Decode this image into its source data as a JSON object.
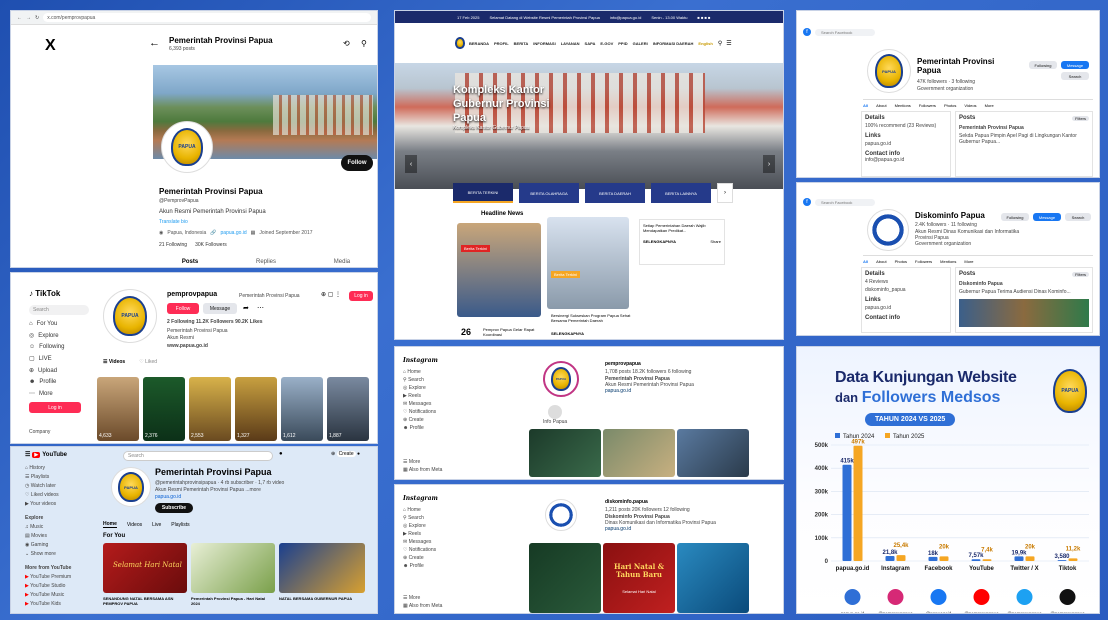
{
  "x_panel": {
    "url": "x.com/pemprovpapua",
    "brand": "X",
    "name": "Pemerintah Provinsi Papua",
    "posts_count": "6,393 posts",
    "handle": "@PemprovPapua",
    "bio": "Akun Resmi Pemerintah Provinsi Papua",
    "translate": "Translate bio",
    "location": "Papua, Indonesia",
    "website": "papua.go.id",
    "joined": "Joined September 2017",
    "following": "21 Following",
    "followers": "30K Followers",
    "follow_btn": "Follow",
    "tabs": [
      "Posts",
      "Replies",
      "Media"
    ],
    "logo_text": "PAPUA"
  },
  "tiktok_panel": {
    "brand": "TikTok",
    "search": "Search",
    "nav": [
      "For You",
      "Explore",
      "Following",
      "LIVE",
      "Upload",
      "Profile",
      "More"
    ],
    "login": "Log in",
    "company": "Company",
    "username": "pemprovpapua",
    "display_name": "Pemerintah Provinsi Papua",
    "follow_btn": "Follow",
    "message_btn": "Message",
    "stats": "2 Following  11.2K Followers  90.2K Likes",
    "bio1": "Pemerintah Provinsi Papua",
    "bio2": "Akun Resmi",
    "link": "www.papua.go.id",
    "tabs": [
      "Videos",
      "Liked"
    ],
    "login_top": "Log in",
    "views": [
      "4,633",
      "2,376",
      "2,553",
      "1,327",
      "1,612",
      "1,887"
    ]
  },
  "youtube_panel": {
    "brand": "YouTube",
    "search": "Search",
    "channel_name": "Pemerintah Provinsi Papua",
    "channel_meta": "@pemerintahprovinsipapua · 4 rb subscriber · 1,7 rb video",
    "channel_desc": "Akun Resmi Pemerintah Provinsi Papua ...more",
    "channel_link": "papua.go.id",
    "subscribe": "Subscribe",
    "tabs": [
      "Home",
      "Videos",
      "Live",
      "Playlists"
    ],
    "section": "For You",
    "sidebar": [
      "Home",
      "Shorts",
      "Subscriptions",
      "You",
      "History",
      "Playlists",
      "Watch later",
      "Liked videos",
      "Your videos",
      "Explore",
      "Music",
      "Movies",
      "Gaming",
      "Show more"
    ],
    "more_from": "More from YouTube",
    "more_items": [
      "YouTube Premium",
      "YouTube Studio",
      "YouTube Music",
      "YouTube Kids"
    ],
    "video_titles": [
      "SENANDUNG NATAL BERSAMA ASN PEMPROV PAPUA",
      "Pemerintah Provinsi Papua - Hari Natal 2024",
      "NATAL BERSAMA GUBERNUR PAPUA"
    ],
    "video_banner": "Selamat Hari Natal"
  },
  "web_panel": {
    "topbar": "Selamat Datang di Website Resmi Pemerintah Provinsi Papua",
    "topbar_email": "info@papua.go.id",
    "topbar_hours": "Senin - 13.00 Waktu",
    "date": "17 Feb 2025",
    "nav": [
      "BERANDA",
      "PROFIL",
      "BERITA",
      "INFORMASI",
      "LAYANAN",
      "SAPA",
      "E-GOV",
      "PPID",
      "GALERI",
      "INFORMASI DAERAH"
    ],
    "lang": "English",
    "hero_title": "Kompleks Kantor Gubernur Provinsi Papua",
    "hero_sub": "Kompleks Kantor Gubernur Papua",
    "tabs": [
      "BERITA TERKINI",
      "BERITA OLAHRAGA",
      "BERITA DAERAH",
      "BERITA LAINNYA"
    ],
    "headline": "Headline News",
    "news_badge": "Berita Terkini",
    "news_badge2": "Berita Terkini",
    "day": "26",
    "news1": "Pemprov Papua Gelar Rapat Koordinasi",
    "news2": "Bersinergi Sukseskan Program Papua Sehat Bersama Pemerintah Daerah",
    "news2_more": "SELENGKAPNYA",
    "side_text": "Setiap Pemerintahan Daerah Wajib Mendapatkan Predikat...",
    "side_more": "SELENGKAPNYA",
    "side_share": "Share"
  },
  "fb_pemprov": {
    "search": "Search Facebook",
    "name": "Pemerintah Provinsi Papua",
    "meta": "47K followers · 3 following",
    "category": "Government organization",
    "btn_following": "Following",
    "btn_message": "Message",
    "btn_search": "Search",
    "tabs": [
      "All",
      "About",
      "Mentions",
      "Followers",
      "Photos",
      "Videos",
      "More"
    ],
    "details": "Details",
    "details_rating": "100% recommend (23 Reviews)",
    "links": "Links",
    "link1": "papua.go.id",
    "contact": "Contact info",
    "contact1": "info@papua.go.id",
    "posts": "Posts",
    "filters": "Filters",
    "post_author": "Pemerintah Provinsi Papua",
    "post_text": "Sekda Papua Pimpin Apel Pagi di Lingkungan Kantor Gubernur Papua..."
  },
  "fb_diskominfo": {
    "search": "Search Facebook",
    "name": "Diskominfo Papua",
    "meta": "2.4K followers · 11 following",
    "desc": "Akun Resmi Dinas Komunikasi dan Informatika Provinsi Papua",
    "category": "Government organization",
    "btn_following": "Following",
    "btn_message": "Message",
    "btn_search": "Search",
    "tabs": [
      "All",
      "About",
      "Photos",
      "Followers",
      "Mentions",
      "More"
    ],
    "details": "Details",
    "rating": "4 Reviews",
    "ig": "diskominfo_papua",
    "links": "Links",
    "link1": "papua.go.id",
    "contact": "Contact info",
    "posts": "Posts",
    "filters": "Filters",
    "post_author": "Diskominfo Papua",
    "post_text": "Gubernur Papua Terima Audiensi Dinas Kominfo..."
  },
  "ig_panel1": {
    "brand": "Instagram",
    "nav": [
      "Home",
      "Search",
      "Explore",
      "Reels",
      "Messages",
      "Notifications",
      "Create",
      "Profile"
    ],
    "more": "More",
    "also": "Also from Meta",
    "username": "pemprovpapua",
    "display": "Pemerintah Provinsi Papua",
    "stats": "1,708 posts  18.2K followers  6 following",
    "bio": "Akun Resmi Pemerintah Provinsi Papua",
    "link": "papua.go.id",
    "highlight": "Info Papua"
  },
  "ig_panel2": {
    "brand": "Instagram",
    "nav": [
      "Home",
      "Search",
      "Explore",
      "Reels",
      "Messages",
      "Notifications",
      "Create",
      "Profile"
    ],
    "more": "More",
    "also": "Also from Meta",
    "username": "diskominfo.papua",
    "display": "Diskominfo Provinsi Papua",
    "stats": "1,211 posts  20K followers  12 following",
    "bio": "Dinas Komunikasi dan Informatika Provinsi Papua",
    "link": "papua.go.id",
    "card_title": "Hari Natal & Tahun Baru",
    "card_sub": "Selamat Hari Natal"
  },
  "chart_panel": {
    "logo": "PAPUA",
    "title_line1": "Data Kunjungan Website",
    "title_line2_a": "dan ",
    "title_line2_b": "Followers Medsos",
    "pill": "TAHUN 2024 VS 2025",
    "platform_handles": [
      "papua.go.id",
      "@pemprovpapua",
      "@papuagoid",
      "@pemprovpapua",
      "@pemprovpapua",
      "@pemprovpapua"
    ],
    "colors": {
      "y2024": "#2f6fd6",
      "y2025": "#f5a623",
      "title": "#1b2a6b",
      "accent": "#2f6fd6"
    }
  },
  "chart_data": {
    "type": "bar",
    "title": "Data Kunjungan Website dan Followers Medsos",
    "categories": [
      "papua.go.id",
      "Instagram",
      "Facebook",
      "YouTube",
      "Twitter / X",
      "Tiktok"
    ],
    "tick_labels": [
      "0",
      "100k",
      "200k",
      "300k",
      "400k",
      "500k"
    ],
    "ylim": [
      0,
      500000
    ],
    "series": [
      {
        "name": "Tahun 2024",
        "values": [
          415000,
          21800,
          18000,
          7570,
          19900,
          3580
        ],
        "labels": [
          "415k",
          "21,8k",
          "18k",
          "7,57k",
          "19,9k",
          "3,580"
        ]
      },
      {
        "name": "Tahun 2025",
        "values": [
          497000,
          25400,
          20000,
          7400,
          20000,
          11200
        ],
        "labels": [
          "497k",
          "25,4k",
          "20k",
          "7,4k",
          "20k",
          "11,2k"
        ]
      }
    ],
    "legend": "top-left"
  }
}
